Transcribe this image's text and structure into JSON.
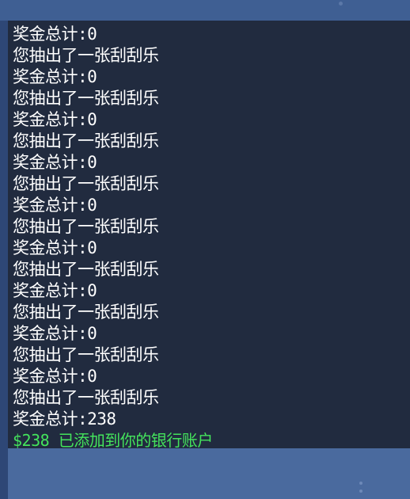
{
  "console": {
    "lines": [
      {
        "text": "奖金总计:0",
        "color": "white"
      },
      {
        "text": "您抽出了一张刮刮乐",
        "color": "white"
      },
      {
        "text": "奖金总计:0",
        "color": "white"
      },
      {
        "text": "您抽出了一张刮刮乐",
        "color": "white"
      },
      {
        "text": "奖金总计:0",
        "color": "white"
      },
      {
        "text": "您抽出了一张刮刮乐",
        "color": "white"
      },
      {
        "text": "奖金总计:0",
        "color": "white"
      },
      {
        "text": "您抽出了一张刮刮乐",
        "color": "white"
      },
      {
        "text": "奖金总计:0",
        "color": "white"
      },
      {
        "text": "您抽出了一张刮刮乐",
        "color": "white"
      },
      {
        "text": "奖金总计:0",
        "color": "white"
      },
      {
        "text": "您抽出了一张刮刮乐",
        "color": "white"
      },
      {
        "text": "奖金总计:0",
        "color": "white"
      },
      {
        "text": "您抽出了一张刮刮乐",
        "color": "white"
      },
      {
        "text": "奖金总计:0",
        "color": "white"
      },
      {
        "text": "您抽出了一张刮刮乐",
        "color": "white"
      },
      {
        "text": "奖金总计:0",
        "color": "white"
      },
      {
        "text": "您抽出了一张刮刮乐",
        "color": "white"
      },
      {
        "text": "奖金总计:238",
        "color": "white"
      },
      {
        "text": "$238 已添加到你的银行账户",
        "color": "green"
      }
    ]
  },
  "colors": {
    "console_bg": "#212b3f",
    "text_white": "#ffffff",
    "text_green": "#44e35c",
    "frame_bg": "#3e5a8a"
  }
}
